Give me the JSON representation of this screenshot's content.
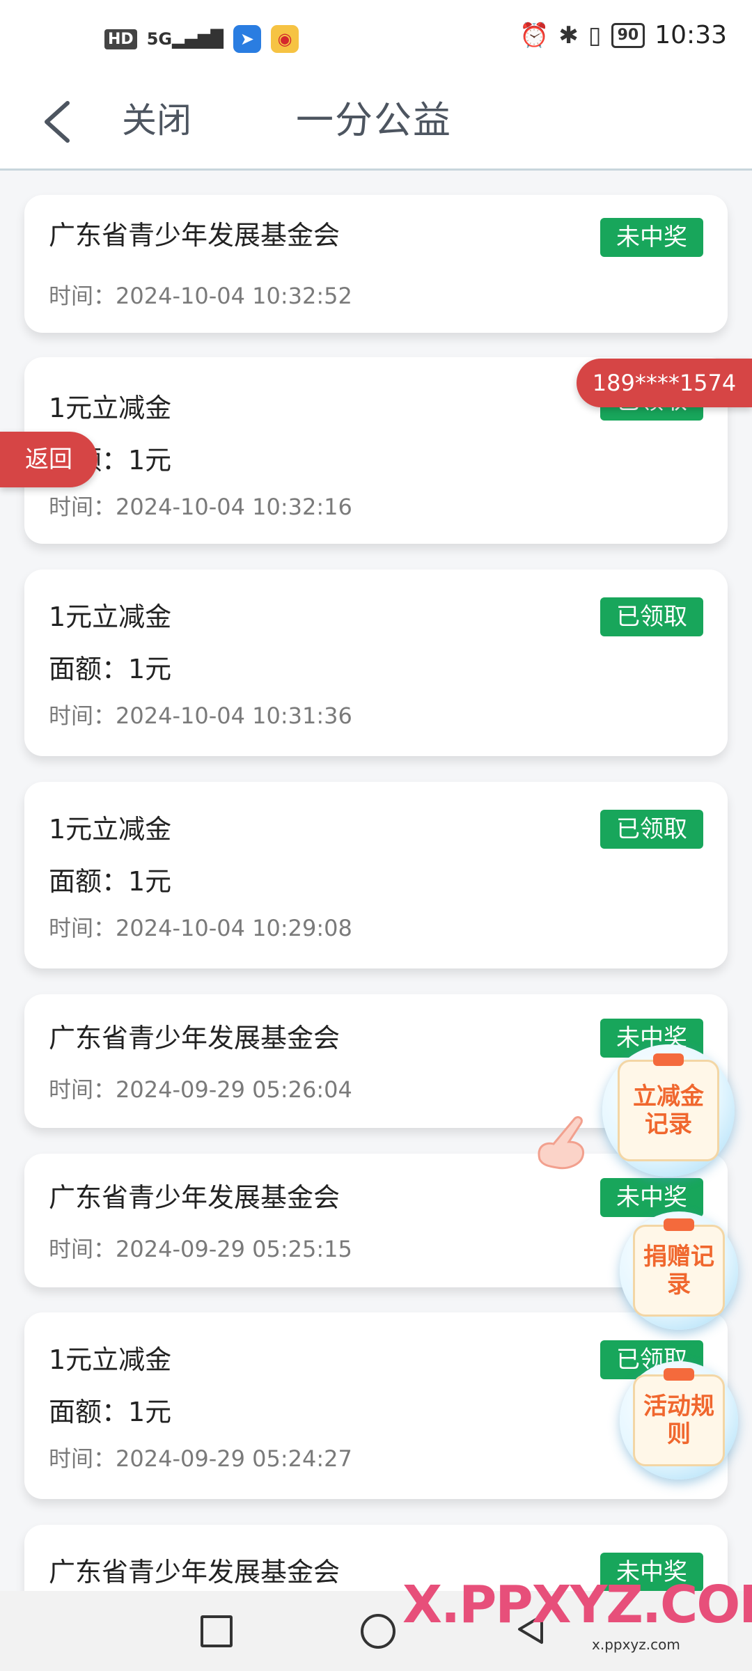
{
  "status_bar": {
    "hd": "HD",
    "signal": "5G",
    "battery": "90",
    "time": "10:33"
  },
  "header": {
    "close_label": "关闭",
    "title": "一分公益"
  },
  "cards": [
    {
      "title": "广东省青少年发展基金会",
      "amount": "",
      "time": "时间：2024-10-04 10:32:52",
      "badge": "未中奖"
    },
    {
      "title": "1元立减金",
      "amount": "面额：1元",
      "time": "时间：2024-10-04 10:32:16",
      "badge": "已领取"
    },
    {
      "title": "1元立减金",
      "amount": "面额：1元",
      "time": "时间：2024-10-04 10:31:36",
      "badge": "已领取"
    },
    {
      "title": "1元立减金",
      "amount": "面额：1元",
      "time": "时间：2024-10-04 10:29:08",
      "badge": "已领取"
    },
    {
      "title": "广东省青少年发展基金会",
      "amount": "",
      "time": "时间：2024-09-29 05:26:04",
      "badge": "未中奖"
    },
    {
      "title": "广东省青少年发展基金会",
      "amount": "",
      "time": "时间：2024-09-29 05:25:15",
      "badge": "未中奖"
    },
    {
      "title": "1元立减金",
      "amount": "面额：1元",
      "time": "时间：2024-09-29 05:24:27",
      "badge": "已领取"
    },
    {
      "title": "广东省青少年发展基金会",
      "amount": "",
      "time": "",
      "badge": "未中奖"
    }
  ],
  "overlays": {
    "phone": "189****1574",
    "return_label": "返回",
    "float_buttons": [
      {
        "label": "立减金记录"
      },
      {
        "label": "捐赠记录"
      },
      {
        "label": "活动规则"
      }
    ]
  },
  "watermark": {
    "main": "X.PPXYZ.COM",
    "sub": "x.ppxyz.com"
  },
  "colors": {
    "badge_green": "#18a65b",
    "tag_red": "#d64545",
    "float_orange": "#f0672e"
  }
}
